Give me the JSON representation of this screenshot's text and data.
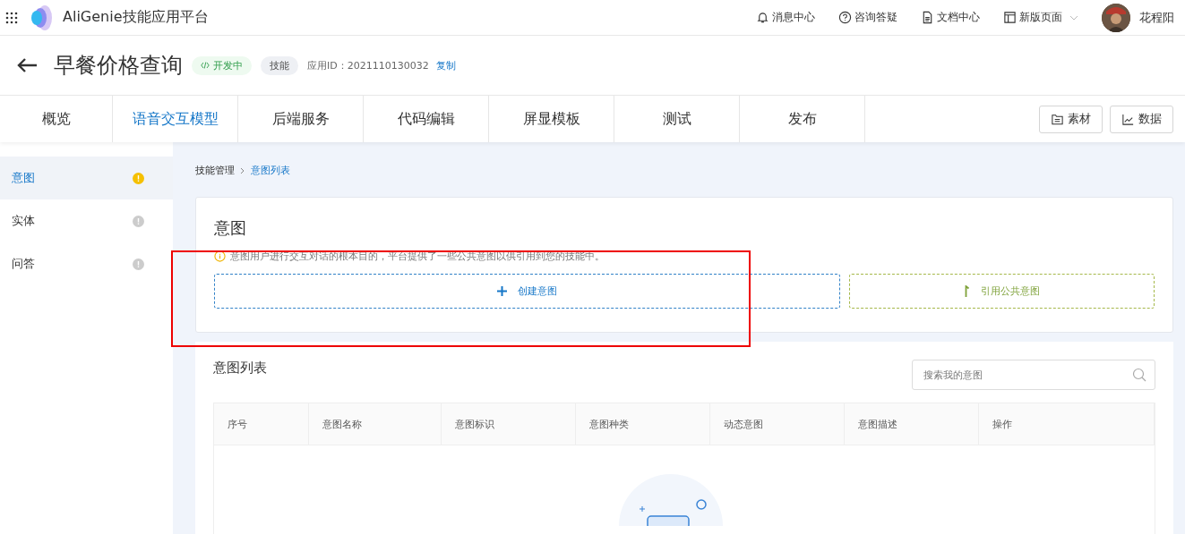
{
  "topbar": {
    "brand": "AliGenie技能应用平台",
    "links": [
      {
        "kind": "bell",
        "label": "消息中心"
      },
      {
        "kind": "help",
        "label": "咨询答疑"
      },
      {
        "kind": "doc",
        "label": "文档中心"
      },
      {
        "kind": "layout",
        "label": "新版页面"
      }
    ],
    "user": "花程阳"
  },
  "header": {
    "title": "早餐价格查询",
    "status": "开发中",
    "type_tag": "技能",
    "app_id_label": "应用ID：2021110130032",
    "copy": "复制"
  },
  "tabs": [
    {
      "label": "概览",
      "selected": false
    },
    {
      "label": "语音交互模型",
      "selected": true
    },
    {
      "label": "后端服务",
      "selected": false
    },
    {
      "label": "代码编辑",
      "selected": false
    },
    {
      "label": "屏显模板",
      "selected": false
    },
    {
      "label": "测试",
      "selected": false
    },
    {
      "label": "发布",
      "selected": false
    }
  ],
  "tool_buttons": [
    {
      "kind": "folder",
      "label": "素材"
    },
    {
      "kind": "chart",
      "label": "数据"
    }
  ],
  "sidebar": {
    "items": [
      {
        "label": "意图",
        "selected": true
      },
      {
        "label": "实体",
        "selected": false
      },
      {
        "label": "问答",
        "selected": false
      }
    ]
  },
  "breadcrumb": [
    "技能管理",
    "意图列表"
  ],
  "intent_card": {
    "title": "意图",
    "hint": "意图用户进行交互对话的根本目的，平台提供了一些公共意图以供引用到您的技能中。",
    "create": "创建意图",
    "reference": "引用公共意图"
  },
  "list": {
    "title": "意图列表",
    "search": {
      "placeholder": "搜索我的意图"
    },
    "columns": [
      "序号",
      "意图名称",
      "意图标识",
      "意图种类",
      "动态意图",
      "意图描述",
      "操作"
    ]
  }
}
